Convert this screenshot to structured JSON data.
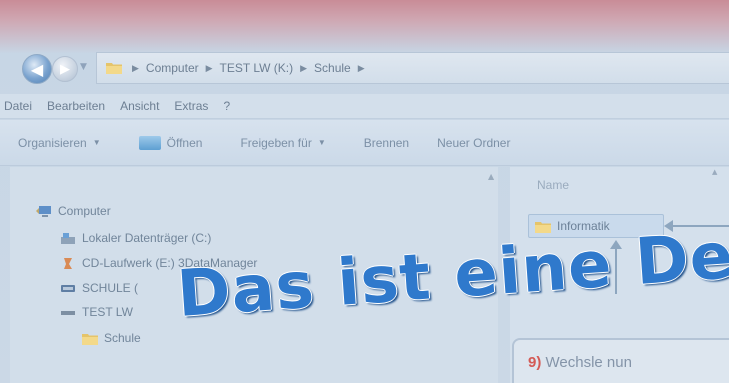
{
  "address_bar": {
    "crumbs": [
      "Computer",
      "TEST LW (K:)",
      "Schule"
    ]
  },
  "menu": {
    "items": [
      "Datei",
      "Bearbeiten",
      "Ansicht",
      "Extras",
      "?"
    ]
  },
  "toolbar": {
    "organize": "Organisieren",
    "open": "Öffnen",
    "share": "Freigeben für",
    "burn": "Brennen",
    "new_folder": "Neuer Ordner"
  },
  "tree": {
    "computer": "Computer",
    "local_disk": "Lokaler Datenträger (C:)",
    "cd_drive": "CD-Laufwerk (E:) 3DataManager",
    "schule_drive": "SCHULE (",
    "test_drive": "TEST LW",
    "schule_folder": "Schule"
  },
  "file_list": {
    "column_name": "Name",
    "items": [
      "Informatik"
    ]
  },
  "overlay": {
    "demo_text": "Das ist eine Dem",
    "callout_number": "9)",
    "callout_text": "Wechsle nun"
  },
  "colors": {
    "accent": "#2f79cc",
    "callout_number": "#d45a55"
  }
}
